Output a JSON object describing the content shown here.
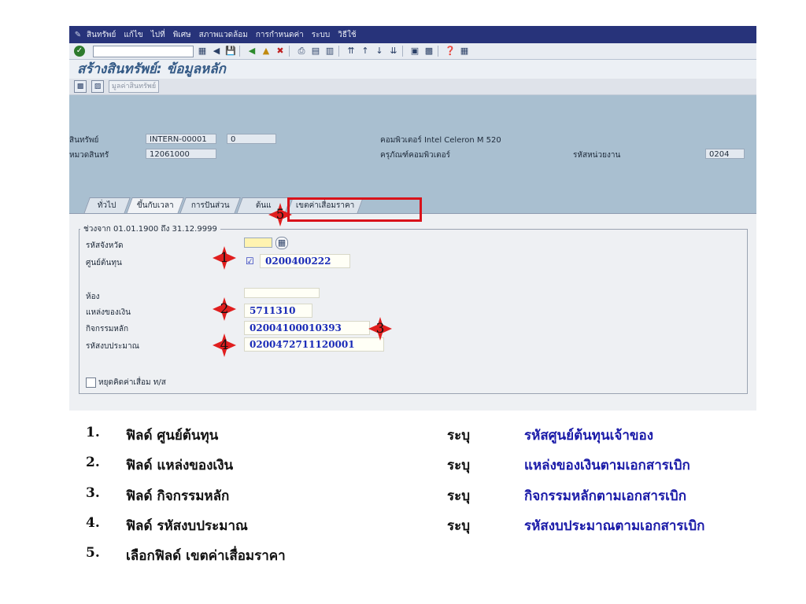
{
  "menu": [
    "สินทรัพย์",
    "แก้ไข",
    "ไปที่",
    "พิเศษ",
    "สภาพแวดล้อม",
    "การกำหนดค่า",
    "ระบบ",
    "วิธีใช้"
  ],
  "title": "สร้างสินทรัพย์: ข้อมูลหลัก",
  "app_toolbar": {
    "master_data_button": "มูลค่าสินทรัพย์"
  },
  "header": {
    "asset_label": "สินทรัพย์",
    "asset_number": "INTERN-00001",
    "asset_sub": "0",
    "asset_desc": "คอมพิวเตอร์ Intel Celeron M 520",
    "class_label": "หมวดสินทรั",
    "class_value": "12061000",
    "class_desc": "ครุภัณฑ์คอมพิวเตอร์",
    "company_label": "รหัสหน่วยงาน",
    "company_value": "0204"
  },
  "tabs": [
    "ทั่วไป",
    "ขึ้นกับเวลา",
    "การปันส่วน",
    "ต้นแ",
    "เขตค่าเสื่อมราคา"
  ],
  "group": {
    "title": "ช่วงจาก 01.01.1900 ถึง 31.12.9999",
    "fields": {
      "plant_label": "รหัสจังหวัด",
      "cost_center_label": "ศูนย์ต้นทุน",
      "cost_center_value": "0200400222",
      "room_label": "ห้อง",
      "fund_label": "แหล่งของเงิน",
      "fund_value": "5711310",
      "activity_label": "กิจกรรมหลัก",
      "activity_value": "02004100010393",
      "budget_label": "รหัสงบประมาณ",
      "budget_value": "0200472711120001"
    },
    "checkbox_label": "หยุดคิดค่าเสื่อม ท/ส"
  },
  "markers": [
    "1",
    "2",
    "3",
    "4",
    "5"
  ],
  "instructions": [
    {
      "num": "1.",
      "label": "ฟิลด์ ศูนย์ต้นทุน",
      "verb": "ระบุ",
      "value": "รหัสศูนย์ต้นทุนเจ้าของ"
    },
    {
      "num": "2.",
      "label": "ฟิลด์ แหล่งของเงิน",
      "verb": "ระบุ",
      "value": "แหล่งของเงินตามเอกสารเบิก"
    },
    {
      "num": "3.",
      "label": "ฟิลด์ กิจกรรมหลัก",
      "verb": "ระบุ",
      "value": "กิจกรรมหลักตามเอกสารเบิก"
    },
    {
      "num": "4.",
      "label": "ฟิลด์ รหัสงบประมาณ",
      "verb": "ระบุ",
      "value": "รหัสงบประมาณตามเอกสารเบิก"
    },
    {
      "num": "5.",
      "label": "เลือกฟิลด์ เขตค่าเสื่อมราคา",
      "verb": "",
      "value": ""
    }
  ]
}
